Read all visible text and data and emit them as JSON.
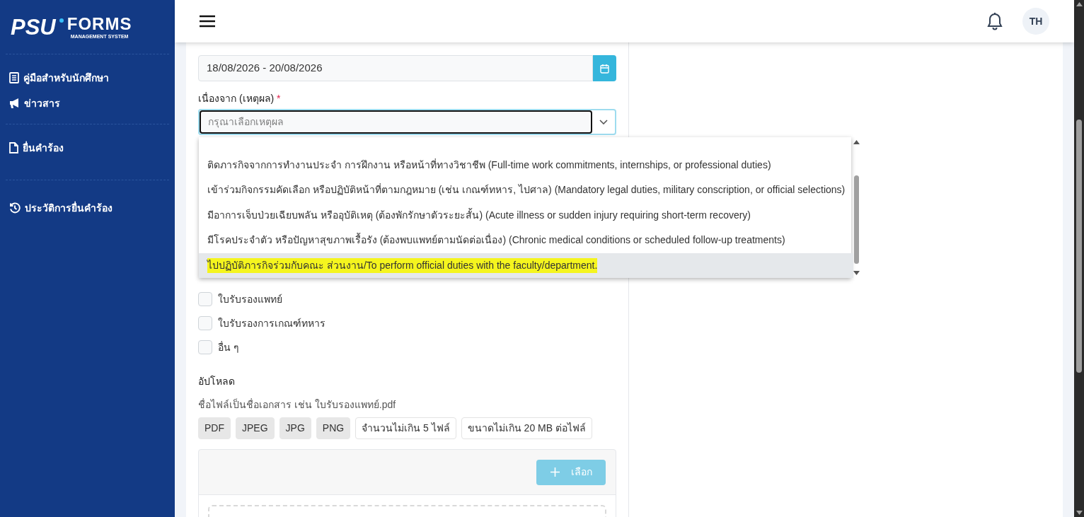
{
  "sidebar": {
    "logo": {
      "mark": "PSU",
      "name": "FORMS",
      "subtitle": "MANAGEMENT SYSTEM"
    },
    "groups": [
      [
        {
          "kind": "book",
          "label": "คู่มือสำหรับนักศึกษา"
        },
        {
          "kind": "megaphone",
          "label": "ข่าวสาร"
        }
      ],
      [
        {
          "kind": "file",
          "label": "ยื่นคำร้อง"
        }
      ],
      [
        {
          "kind": "history",
          "label": "ประวัติการยื่นคำร้อง"
        }
      ]
    ]
  },
  "header": {
    "avatar": "TH"
  },
  "form": {
    "date_range": {
      "value": "18/08/2026 - 20/08/2026"
    },
    "reason": {
      "label": "เนื่องจาก (เหตุผล)",
      "required_mark": "*",
      "placeholder": "กรุณาเลือกเหตุผล",
      "expanded": true,
      "options": [
        {
          "label": "ติดภารกิจจากการทำงานประจำ การฝึกงาน หรือหน้าที่ทางวิชาชีพ (Full-time work commitments, internships, or professional duties)",
          "selected": false
        },
        {
          "label": "เข้าร่วมกิจกรรมคัดเลือก หรือปฏิบัติหน้าที่ตามกฎหมาย (เช่น เกณฑ์ทหาร, ไปศาล) (Mandatory legal duties, military conscription, or official selections)",
          "selected": false
        },
        {
          "label": "มีอาการเจ็บป่วยเฉียบพลัน หรืออุบัติเหตุ (ต้องพักรักษาตัวระยะสั้น) (Acute illness or sudden injury requiring short-term recovery)",
          "selected": false
        },
        {
          "label": "มีโรคประจำตัว หรือปัญหาสุขภาพเรื้อรัง (ต้องพบแพทย์ตามนัดต่อเนื่อง) (Chronic medical conditions or scheduled follow-up treatments)",
          "selected": false
        },
        {
          "label": "ไปปฏิบัติภารกิจร่วมกับคณะ ส่วนงาน/To perform official duties with the faculty/department.",
          "selected": true
        }
      ]
    },
    "attachments": [
      {
        "label": "ใบรับรองแพทย์",
        "checked": false
      },
      {
        "label": "ใบรับรองการเกณฑ์ทหาร",
        "checked": false
      },
      {
        "label": "อื่น ๆ",
        "checked": false
      }
    ],
    "upload": {
      "label": "อัปโหลด",
      "hint": "ชื่อไฟล์เป็นชื่อเอกสาร เช่น ใบรับรองแพทย์.pdf",
      "chips": [
        {
          "kind": "type",
          "label": "PDF"
        },
        {
          "kind": "type",
          "label": "JPEG"
        },
        {
          "kind": "type",
          "label": "JPG"
        },
        {
          "kind": "type",
          "label": "PNG"
        },
        {
          "kind": "limit",
          "label": "จำนวนไม่เกิน 5 ไฟล์"
        },
        {
          "kind": "limit",
          "label": "ขนาดไม่เกิน 20 MB ต่อไฟล์"
        }
      ],
      "button": {
        "label": "เลือก",
        "disabled": true
      }
    }
  }
}
